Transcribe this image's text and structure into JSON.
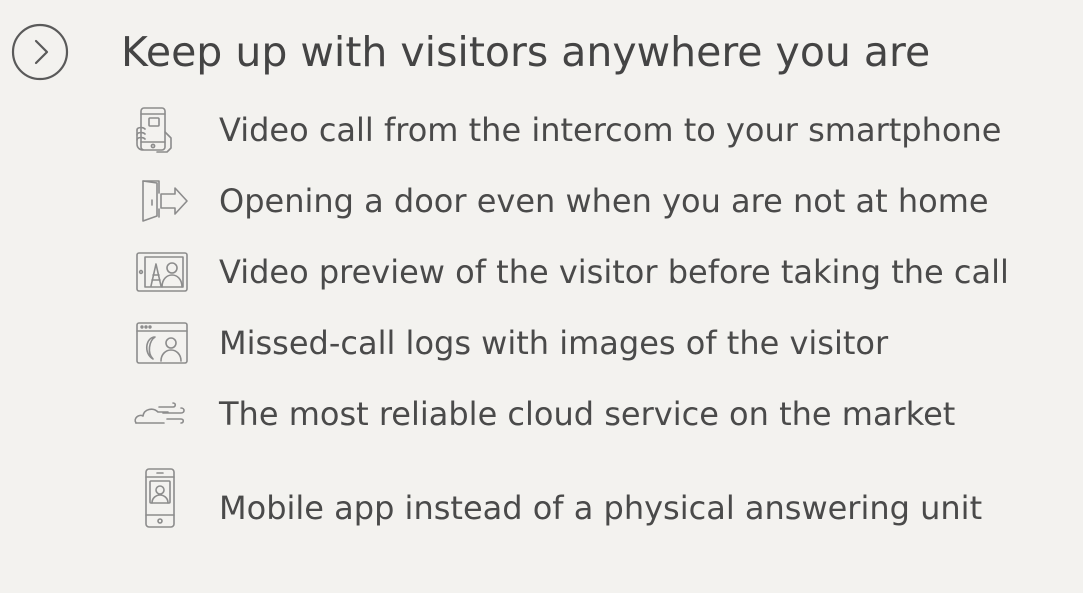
{
  "header": {
    "title": "Keep up with visitors anywhere you are",
    "expand_icon": "chevron-right-circle-icon"
  },
  "features": [
    {
      "icon": "smartphone-hand-icon",
      "label": "Video call from the intercom to your smartphone"
    },
    {
      "icon": "door-open-arrow-icon",
      "label": "Opening a door even when you are not at home"
    },
    {
      "icon": "video-preview-icon",
      "label": "Video preview of the visitor before taking the call"
    },
    {
      "icon": "missed-call-log-icon",
      "label": "Missed-call logs with images of the visitor"
    },
    {
      "icon": "cloud-icon",
      "label": "The most reliable cloud service on the market"
    },
    {
      "icon": "mobile-app-icon",
      "label": "Mobile app instead of a physical answering unit"
    }
  ],
  "colors": {
    "background": "#f3f2ef",
    "text": "#4a4a4a",
    "icon": "#8c8c8c"
  }
}
